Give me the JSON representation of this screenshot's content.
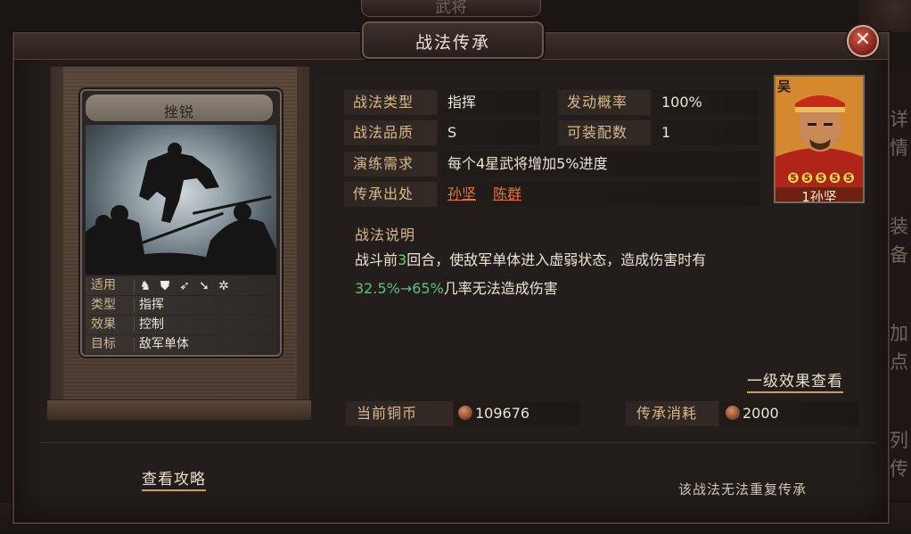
{
  "background": {
    "top_tab_text": "武将",
    "right_side_chars": [
      "详",
      "情",
      "装",
      "备",
      "加",
      "点",
      "列",
      "传"
    ]
  },
  "dialog": {
    "title": "战法传承",
    "close_icon": "close-x-icon"
  },
  "card": {
    "name": "挫锐",
    "rows": {
      "suitable_label": "适用",
      "suitable_icons": [
        "cavalry-icon",
        "shield-icon",
        "bow-icon",
        "spear-icon",
        "wheel-icon"
      ],
      "type_label": "类型",
      "type_value": "指挥",
      "effect_label": "效果",
      "effect_value": "控制",
      "target_label": "目标",
      "target_value": "敌军单体"
    }
  },
  "info": {
    "tactic_type_label": "战法类型",
    "tactic_type_value": "指挥",
    "trigger_rate_label": "发动概率",
    "trigger_rate_value": "100%",
    "quality_label": "战法品质",
    "quality_value": "S",
    "equip_count_label": "可装配数",
    "equip_count_value": "1",
    "train_label": "演练需求",
    "train_value": "每个4星武将增加5%进度",
    "source_label": "传承出处",
    "source_values": [
      "孙坚",
      "陈群"
    ]
  },
  "description": {
    "label": "战法说明",
    "line1_prefix": "战斗前",
    "line1_num": "3",
    "line1_suffix": "回合，使敌军单体进入虚弱状态，造成伤害时有",
    "line2_range": "32.5%→65%",
    "line2_suffix": "几率无法造成伤害"
  },
  "level_link": "一级效果查看",
  "currency": {
    "copper_label": "当前铜币",
    "copper_value": "109676",
    "cost_label": "传承消耗",
    "cost_value": "2000",
    "coin_icon": "copper-coin-icon"
  },
  "portrait": {
    "faction": "吴",
    "stars": [
      "❺",
      "❺",
      "❺",
      "❺",
      "❺"
    ],
    "name": "1孙坚"
  },
  "footer": {
    "guide_link": "查看攻略",
    "note": "该战法无法重复传承"
  },
  "colors": {
    "accent_gold": "#d8b88a",
    "link_orange": "#e7743a",
    "highlight_green": "#6fcf6a",
    "underline_gold": "#c9a24a"
  }
}
